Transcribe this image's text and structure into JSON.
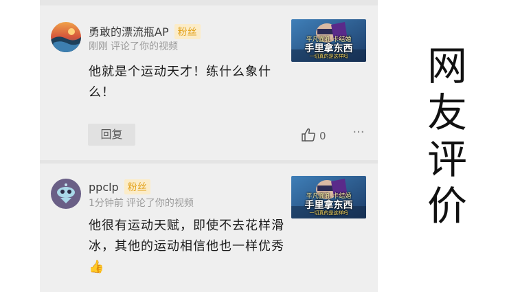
{
  "side_title": "网友评价",
  "comments": [
    {
      "username": "勇敢的漂流瓶AP",
      "badge": "粉丝",
      "time": "刚刚",
      "action": "评论了你的视频",
      "text": "他就是个运动天才！练什么象什么！",
      "thumbnail": {
        "line1": "平凡面孔 卡结婚",
        "line2": "手里拿东西",
        "line3": "一切真的是这样吗"
      },
      "reply_label": "回复",
      "like_count": "0",
      "icons": {
        "like": "thumbs-up-icon",
        "more": "more-dots-icon"
      }
    },
    {
      "username": "ppclp",
      "badge": "粉丝",
      "time": "1分钟前",
      "action": "评论了你的视频",
      "text": "他很有运动天赋，即使不去花样滑冰，其他的运动相信他也一样优秀",
      "emoji": "👍",
      "thumbnail": {
        "line1": "平凡面孔 卡结婚",
        "line2": "手里拿东西",
        "line3": "一切真的是这样吗"
      }
    }
  ],
  "colors": {
    "panel_bg": "#efefef",
    "badge_text": "#e3a21a",
    "badge_bg": "#fbecc9"
  }
}
